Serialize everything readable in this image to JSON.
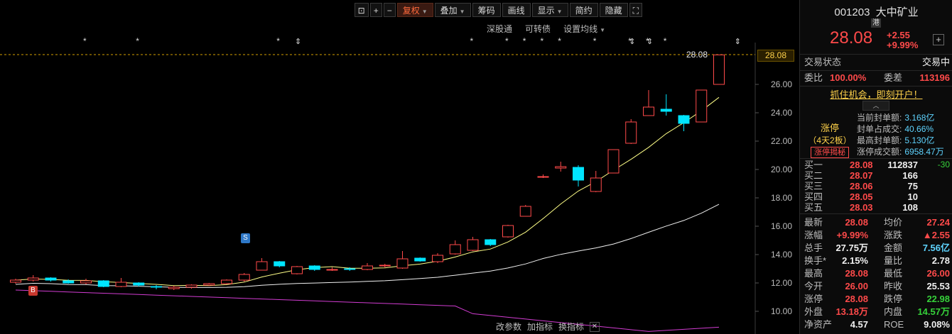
{
  "toolbar": {
    "buttons": [
      "复权",
      "叠加",
      "筹码",
      "画线",
      "显示",
      "简约",
      "隐藏"
    ],
    "fuquan_label": "复权",
    "diejia_label": "叠加",
    "chouma_label": "筹码",
    "huaxian_label": "画线",
    "xianshi_label": "显示",
    "jianyue_label": "简约",
    "yincang_label": "隐藏"
  },
  "subtoolbar": {
    "shengutong": "深股通",
    "kezhuanzhai": "可转债",
    "set_ma": "设置均线"
  },
  "bottombar": {
    "gai_canshu": "改参数",
    "jia_zhibiao": "加指标",
    "huan_zhibiao": "换指标"
  },
  "chart_data": {
    "type": "candlestick",
    "current_price_label": "28.08",
    "ylim": [
      9.0,
      29.0
    ],
    "yticks": [
      "28.08",
      "26.00",
      "24.00",
      "22.00",
      "20.00",
      "18.00",
      "16.00",
      "14.00",
      "12.00",
      "10.00"
    ],
    "ytick_values": [
      28.08,
      26,
      24,
      22,
      20,
      18,
      16,
      14,
      12,
      10
    ],
    "markers": {
      "buy": "B",
      "sell": "S"
    },
    "candles": [
      {
        "o": 12.05,
        "c": 12.2,
        "h": 12.3,
        "l": 11.95
      },
      {
        "o": 12.2,
        "c": 12.35,
        "h": 12.55,
        "l": 12.1
      },
      {
        "o": 12.35,
        "c": 12.2,
        "h": 12.4,
        "l": 12.1
      },
      {
        "o": 12.15,
        "c": 12.0,
        "h": 12.25,
        "l": 11.95
      },
      {
        "o": 12.0,
        "c": 12.15,
        "h": 12.3,
        "l": 11.9
      },
      {
        "o": 12.15,
        "c": 11.75,
        "h": 12.2,
        "l": 11.7
      },
      {
        "o": 11.75,
        "c": 12.05,
        "h": 12.35,
        "l": 11.7
      },
      {
        "o": 12.0,
        "c": 11.85,
        "h": 12.05,
        "l": 11.75
      },
      {
        "o": 11.75,
        "c": 11.7,
        "h": 11.85,
        "l": 11.55
      },
      {
        "o": 11.6,
        "c": 11.7,
        "h": 11.8,
        "l": 11.5
      },
      {
        "o": 11.7,
        "c": 11.85,
        "h": 11.9,
        "l": 11.6
      },
      {
        "o": 11.85,
        "c": 11.95,
        "h": 12.0,
        "l": 11.8
      },
      {
        "o": 11.95,
        "c": 12.2,
        "h": 12.25,
        "l": 11.9
      },
      {
        "o": 12.2,
        "c": 12.6,
        "h": 12.7,
        "l": 12.1
      },
      {
        "o": 12.9,
        "c": 13.5,
        "h": 13.75,
        "l": 12.9
      },
      {
        "o": 13.5,
        "c": 13.2,
        "h": 13.55,
        "l": 13.1
      },
      {
        "o": 12.65,
        "c": 13.15,
        "h": 13.2,
        "l": 12.6
      },
      {
        "o": 13.2,
        "c": 12.95,
        "h": 13.25,
        "l": 12.85
      },
      {
        "o": 12.95,
        "c": 12.95,
        "h": 13.1,
        "l": 12.85
      },
      {
        "o": 13.0,
        "c": 12.95,
        "h": 13.1,
        "l": 12.85
      },
      {
        "o": 12.95,
        "c": 13.2,
        "h": 13.4,
        "l": 12.9
      },
      {
        "o": 13.2,
        "c": 13.25,
        "h": 13.35,
        "l": 13.1
      },
      {
        "o": 13.05,
        "c": 13.7,
        "h": 14.25,
        "l": 13.0
      },
      {
        "o": 13.75,
        "c": 13.55,
        "h": 13.8,
        "l": 13.5
      },
      {
        "o": 13.5,
        "c": 13.95,
        "h": 14.1,
        "l": 13.4
      },
      {
        "o": 14.05,
        "c": 14.7,
        "h": 15.0,
        "l": 14.0
      },
      {
        "o": 14.3,
        "c": 15.05,
        "h": 15.25,
        "l": 14.25
      },
      {
        "o": 15.05,
        "c": 14.7,
        "h": 15.1,
        "l": 14.6
      },
      {
        "o": 15.25,
        "c": 16.05,
        "h": 16.1,
        "l": 15.2
      },
      {
        "o": 16.7,
        "c": 17.4,
        "h": 17.5,
        "l": 16.7
      },
      {
        "o": 19.45,
        "c": 19.5,
        "h": 19.65,
        "l": 19.4
      },
      {
        "o": 20.1,
        "c": 20.2,
        "h": 20.55,
        "l": 19.85
      },
      {
        "o": 20.15,
        "c": 19.25,
        "h": 20.3,
        "l": 18.8
      },
      {
        "o": 18.45,
        "c": 19.4,
        "h": 19.9,
        "l": 18.4
      },
      {
        "o": 19.75,
        "c": 21.4,
        "h": 21.4,
        "l": 19.75
      },
      {
        "o": 21.85,
        "c": 23.35,
        "h": 23.55,
        "l": 21.8
      },
      {
        "o": 23.8,
        "c": 24.4,
        "h": 25.6,
        "l": 23.8
      },
      {
        "o": 24.25,
        "c": 24.1,
        "h": 25.3,
        "l": 23.8
      },
      {
        "o": 23.8,
        "c": 23.25,
        "h": 23.85,
        "l": 22.7
      },
      {
        "o": 23.35,
        "c": 25.6,
        "h": 25.6,
        "l": 23.35
      },
      {
        "o": 26.0,
        "c": 28.08,
        "h": 28.08,
        "l": 26.0
      }
    ]
  },
  "panel": {
    "code": "001203",
    "name": "大中矿业",
    "tag": "港",
    "price": "28.08",
    "change": "+2.55",
    "change_pct": "+9.99%",
    "trade_status_label": "交易状态",
    "trade_status": "交易中",
    "weibi_label": "委比",
    "weibi": "100.00%",
    "weicha_label": "委差",
    "weicha": "113196",
    "promo": "抓住机会，即刻开户！",
    "limitup_title": "涨停",
    "limitup_days": "（4天2板）",
    "limitup_reveal": "涨停揭秘",
    "seal_rows": [
      {
        "label": "当前封单额:",
        "value": "3.168亿"
      },
      {
        "label": "封单占成交:",
        "value": "40.66%"
      },
      {
        "label": "最高封单额:",
        "value": "5.130亿"
      },
      {
        "label": "涨停成交额:",
        "value": "6958.47万"
      }
    ],
    "bids": [
      {
        "label": "买一",
        "price": "28.08",
        "vol": "112837",
        "chg": "-30"
      },
      {
        "label": "买二",
        "price": "28.07",
        "vol": "166",
        "chg": ""
      },
      {
        "label": "买三",
        "price": "28.06",
        "vol": "75",
        "chg": ""
      },
      {
        "label": "买四",
        "price": "28.05",
        "vol": "10",
        "chg": ""
      },
      {
        "label": "买五",
        "price": "28.03",
        "vol": "108",
        "chg": ""
      }
    ],
    "stats": [
      {
        "l1": "最新",
        "v1": "28.08",
        "c1": "red",
        "l2": "均价",
        "v2": "27.24",
        "c2": "red"
      },
      {
        "l1": "涨幅",
        "v1": "+9.99%",
        "c1": "red",
        "l2": "涨跌",
        "v2": "▲2.55",
        "c2": "red"
      },
      {
        "l1": "总手",
        "v1": "27.75万",
        "c1": "white",
        "l2": "金额",
        "v2": "7.56亿",
        "c2": "cyan"
      },
      {
        "l1": "换手*",
        "v1": "2.15%",
        "c1": "white",
        "l2": "量比",
        "v2": "2.78",
        "c2": "white"
      },
      {
        "l1": "最高",
        "v1": "28.08",
        "c1": "red",
        "l2": "最低",
        "v2": "26.00",
        "c2": "red"
      },
      {
        "l1": "今开",
        "v1": "26.00",
        "c1": "red",
        "l2": "昨收",
        "v2": "25.53",
        "c2": "white"
      },
      {
        "l1": "涨停",
        "v1": "28.08",
        "c1": "red",
        "l2": "跌停",
        "v2": "22.98",
        "c2": "green"
      },
      {
        "l1": "外盘",
        "v1": "13.18万",
        "c1": "red",
        "l2": "内盘",
        "v2": "14.57万",
        "c2": "green"
      },
      {
        "l1": "净资产",
        "v1": "4.57",
        "c1": "white",
        "l2": "ROE",
        "v2": "9.08%",
        "c2": "white"
      }
    ]
  },
  "colors": {
    "up": "#ff4a4a",
    "down": "#00e5ff",
    "ma1": "#ffff88",
    "ma2": "#f0f0f0",
    "ma3": "#d23cd2"
  }
}
